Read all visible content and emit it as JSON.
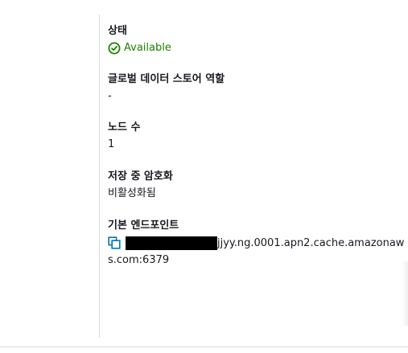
{
  "details": {
    "status": {
      "label": "상태",
      "value": "Available",
      "color": "#1d8102",
      "icon": "status-positive-icon"
    },
    "global_datastore_role": {
      "label": "글로벌 데이터 스토어 역할",
      "value": "-"
    },
    "node_count": {
      "label": "노드 수",
      "value": "1"
    },
    "encryption_at_rest": {
      "label": "저장 중 암호화",
      "value": "비활성화됨"
    },
    "primary_endpoint": {
      "label": "기본 엔드포인트",
      "copy_icon": "copy-icon",
      "value_visible_line1": "jjyy.ng.0001.apn2.cache.amazonaw",
      "value_visible_line2": "s.com:6379",
      "redacted": true,
      "link_color": "#0073bb"
    }
  }
}
